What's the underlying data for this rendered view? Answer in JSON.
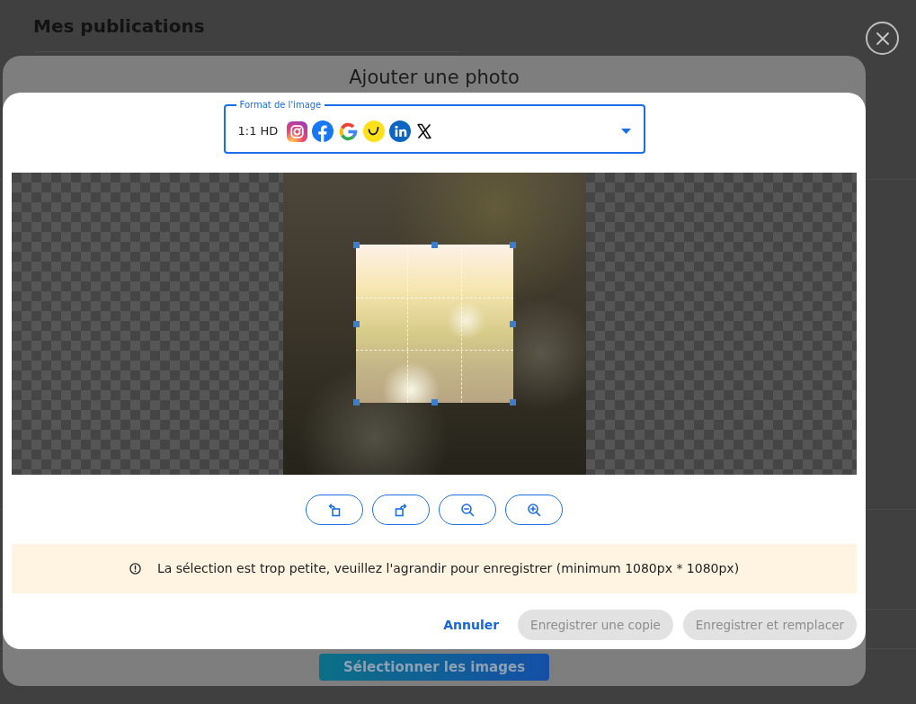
{
  "page": {
    "title": "Mes publications"
  },
  "upload_dialog": {
    "title": "Ajouter une photo",
    "select_button": "Sélectionner les images"
  },
  "photo_editor": {
    "format_field": {
      "label": "Format de l'image",
      "value": "1:1 HD"
    },
    "warning": {
      "text": "La sélection est trop petite, veuillez l'agrandir pour enregistrer (minimum 1080px * 1080px)"
    },
    "cancel_link": "Annuler",
    "buttons": [
      {
        "label": "Enregistrer une copie",
        "disabled": true
      },
      {
        "label": "Enregistrer et remplacer",
        "disabled": true
      }
    ]
  }
}
